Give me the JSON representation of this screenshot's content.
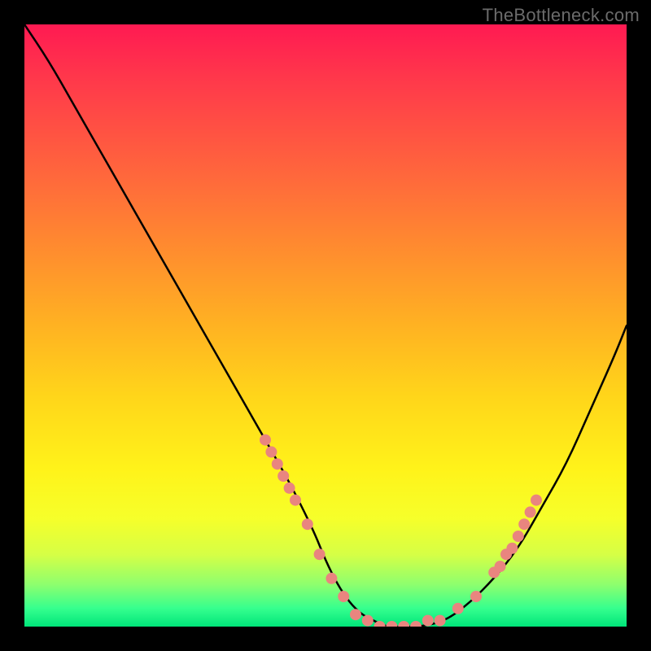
{
  "watermark": "TheBottleneck.com",
  "chart_data": {
    "type": "line",
    "title": "",
    "xlabel": "",
    "ylabel": "",
    "xlim": [
      0,
      100
    ],
    "ylim": [
      0,
      100
    ],
    "background_gradient_stops": [
      {
        "pos": 0,
        "color": "#ff1a52"
      },
      {
        "pos": 10,
        "color": "#ff3b4a"
      },
      {
        "pos": 26,
        "color": "#ff6a3b"
      },
      {
        "pos": 38,
        "color": "#ff8e2e"
      },
      {
        "pos": 50,
        "color": "#ffb222"
      },
      {
        "pos": 62,
        "color": "#ffd61a"
      },
      {
        "pos": 74,
        "color": "#fff31a"
      },
      {
        "pos": 82,
        "color": "#f6ff2a"
      },
      {
        "pos": 88,
        "color": "#d6ff45"
      },
      {
        "pos": 93,
        "color": "#8eff6e"
      },
      {
        "pos": 97,
        "color": "#35ff8e"
      },
      {
        "pos": 100,
        "color": "#00e57a"
      }
    ],
    "series": [
      {
        "name": "bottleneck-curve",
        "color": "#000000",
        "x": [
          0,
          4,
          8,
          12,
          16,
          20,
          24,
          28,
          32,
          36,
          40,
          44,
          48,
          50,
          52,
          54,
          56,
          58,
          60,
          62,
          66,
          70,
          74,
          78,
          82,
          86,
          90,
          94,
          98,
          100
        ],
        "y": [
          100,
          94,
          87,
          80,
          73,
          66,
          59,
          52,
          45,
          38,
          31,
          24,
          16,
          11,
          7,
          4,
          2,
          1,
          0,
          0,
          0,
          1,
          4,
          8,
          13,
          20,
          27,
          36,
          45,
          50
        ]
      }
    ],
    "markers": {
      "name": "highlight-dots",
      "color": "#e9857f",
      "radius": 7,
      "points": [
        {
          "x": 40,
          "y": 31
        },
        {
          "x": 41,
          "y": 29
        },
        {
          "x": 42,
          "y": 27
        },
        {
          "x": 43,
          "y": 25
        },
        {
          "x": 44,
          "y": 23
        },
        {
          "x": 45,
          "y": 21
        },
        {
          "x": 47,
          "y": 17
        },
        {
          "x": 49,
          "y": 12
        },
        {
          "x": 51,
          "y": 8
        },
        {
          "x": 53,
          "y": 5
        },
        {
          "x": 55,
          "y": 2
        },
        {
          "x": 57,
          "y": 1
        },
        {
          "x": 59,
          "y": 0
        },
        {
          "x": 61,
          "y": 0
        },
        {
          "x": 63,
          "y": 0
        },
        {
          "x": 65,
          "y": 0
        },
        {
          "x": 67,
          "y": 1
        },
        {
          "x": 69,
          "y": 1
        },
        {
          "x": 72,
          "y": 3
        },
        {
          "x": 75,
          "y": 5
        },
        {
          "x": 78,
          "y": 9
        },
        {
          "x": 79,
          "y": 10
        },
        {
          "x": 80,
          "y": 12
        },
        {
          "x": 81,
          "y": 13
        },
        {
          "x": 82,
          "y": 15
        },
        {
          "x": 83,
          "y": 17
        },
        {
          "x": 84,
          "y": 19
        },
        {
          "x": 85,
          "y": 21
        }
      ]
    }
  }
}
